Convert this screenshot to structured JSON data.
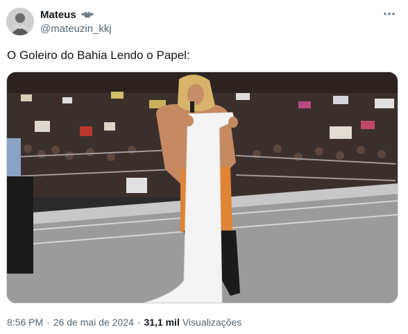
{
  "author": {
    "display_name": "Mateus",
    "handle": "@mateuzin_kkj",
    "name_icon": "bat-emblem-icon"
  },
  "post": {
    "text": "O Goleiro do Bahia Lendo o Papel:",
    "media_icon": "photo-wrestler-reading-long-paper"
  },
  "meta": {
    "time": "8:56 PM",
    "separator": "·",
    "date": "26 de mai de 2024",
    "views_count": "31,1 mil",
    "views_label": "Visualizações"
  },
  "colors": {
    "text_primary": "#0f1419",
    "text_secondary": "#536471",
    "border": "#cfd9de"
  }
}
